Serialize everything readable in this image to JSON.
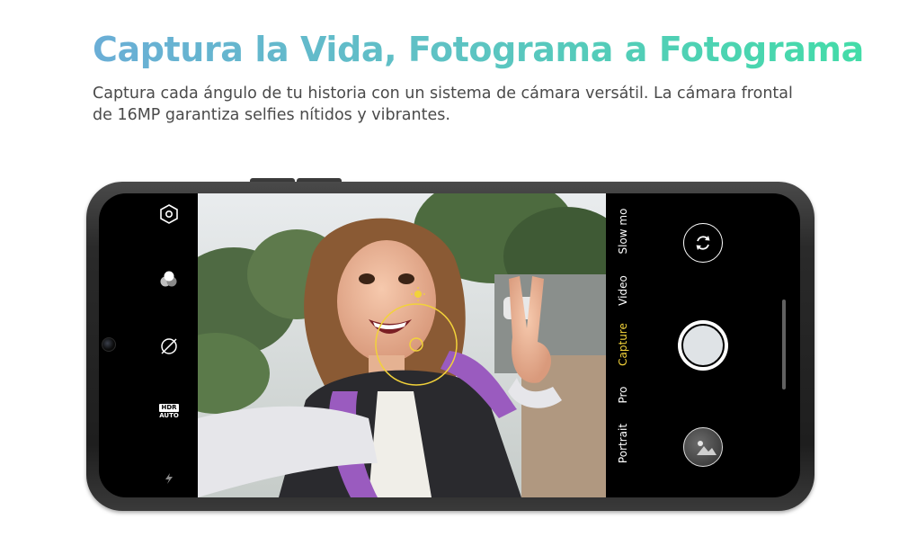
{
  "header": {
    "title": "Captura la Vida, Fotograma a Fotograma",
    "subtitle": "Captura cada ángulo de tu historia con un sistema de cámara versátil. La cámara frontal de 16MP garantiza selfies nítidos y vibrantes."
  },
  "camera_app": {
    "left_toolbar": [
      {
        "icon": "settings-hexagon-icon"
      },
      {
        "icon": "filter-circles-icon"
      },
      {
        "icon": "timer-off-icon"
      },
      {
        "icon": "hdr-auto-icon",
        "label_top": "HDR",
        "label_bottom": "AUTO"
      },
      {
        "icon": "flash-icon"
      }
    ],
    "modes": [
      "Portrait",
      "Pro",
      "Capture",
      "Video",
      "Slow mo"
    ],
    "active_mode": "Capture",
    "focus_color": "#f2d23a",
    "accent_active_mode": "#f2d23a"
  }
}
